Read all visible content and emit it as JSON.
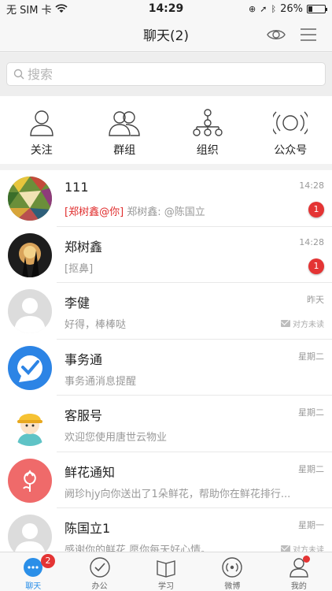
{
  "status_bar": {
    "carrier": "无 SIM 卡",
    "time": "14:29",
    "battery": "26%",
    "battery_level": 0.26
  },
  "nav": {
    "title": "聊天(2)"
  },
  "search": {
    "placeholder": "搜索"
  },
  "quick_actions": [
    {
      "label": "关注",
      "icon": "person-icon"
    },
    {
      "label": "群组",
      "icon": "group-icon"
    },
    {
      "label": "组织",
      "icon": "org-chart-icon"
    },
    {
      "label": "公众号",
      "icon": "broadcast-icon"
    }
  ],
  "chats": [
    {
      "name": "111",
      "time": "14:28",
      "mention": "[郑树鑫@你]",
      "preview": " 郑树鑫: @陈国立",
      "unread": "1",
      "status": ""
    },
    {
      "name": "郑树鑫",
      "time": "14:28",
      "mention": "",
      "preview": "[抠鼻]",
      "unread": "1",
      "status": ""
    },
    {
      "name": "李健",
      "time": "昨天",
      "mention": "",
      "preview": "好得，棒棒哒",
      "unread": "",
      "status": "对方未读"
    },
    {
      "name": "事务通",
      "time": "星期二",
      "mention": "",
      "preview": "事务通消息提醒",
      "unread": "",
      "status": ""
    },
    {
      "name": "客服号",
      "time": "星期二",
      "mention": "",
      "preview": "欢迎您使用唐世云物业",
      "unread": "",
      "status": ""
    },
    {
      "name": "鲜花通知",
      "time": "星期二",
      "mention": "",
      "preview": "阙珍hjy向你送出了1朵鲜花，帮助你在鲜花排行...",
      "unread": "",
      "status": ""
    },
    {
      "name": "陈国立1",
      "time": "星期一",
      "mention": "",
      "preview": "感谢你的鲜花,愿你每天好心情。",
      "unread": "",
      "status": "对方未读"
    }
  ],
  "tabs": [
    {
      "label": "聊天",
      "badge": "2",
      "active": true
    },
    {
      "label": "办公",
      "badge": "",
      "active": false
    },
    {
      "label": "学习",
      "badge": "",
      "active": false
    },
    {
      "label": "微博",
      "badge": "",
      "active": false
    },
    {
      "label": "我的",
      "badge": "",
      "active": false
    }
  ],
  "colors": {
    "accent": "#2b8fe8",
    "badge": "#e43434",
    "mention": "#e02e2e"
  }
}
